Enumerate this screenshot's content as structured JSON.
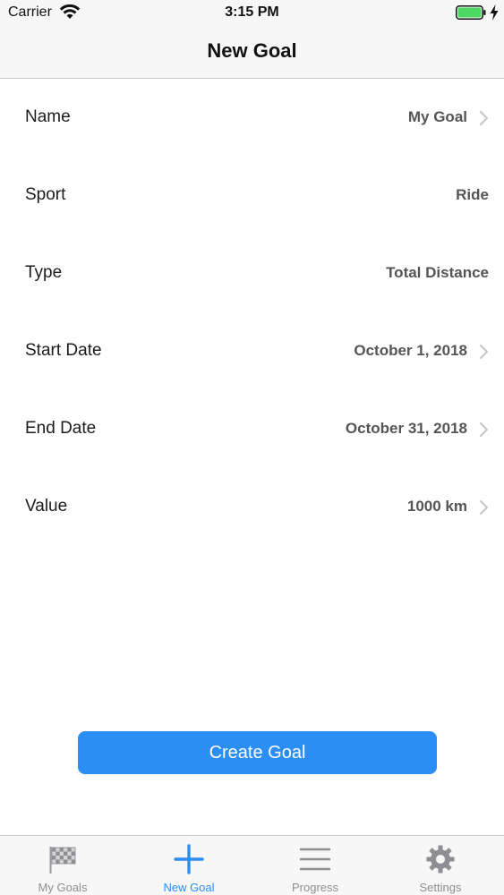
{
  "status_bar": {
    "carrier": "Carrier",
    "time": "3:15 PM"
  },
  "nav": {
    "title": "New Goal"
  },
  "form": {
    "rows": [
      {
        "label": "Name",
        "value": "My Goal"
      },
      {
        "label": "Sport",
        "value": "Ride"
      },
      {
        "label": "Type",
        "value": "Total Distance"
      },
      {
        "label": "Start Date",
        "value": "October 1, 2018"
      },
      {
        "label": "End Date",
        "value": "October 31, 2018"
      },
      {
        "label": "Value",
        "value": "1000 km"
      }
    ]
  },
  "create_button": {
    "label": "Create Goal"
  },
  "tab_bar": {
    "tabs": [
      {
        "label": "My Goals",
        "icon": "checkered-flag-icon"
      },
      {
        "label": "New Goal",
        "icon": "plus-icon",
        "active": true
      },
      {
        "label": "Progress",
        "icon": "list-icon"
      },
      {
        "label": "Settings",
        "icon": "gear-icon"
      }
    ]
  },
  "colors": {
    "accent": "#2b8ef5",
    "battery": "#4cd964",
    "inactive": "#8e8e93"
  }
}
